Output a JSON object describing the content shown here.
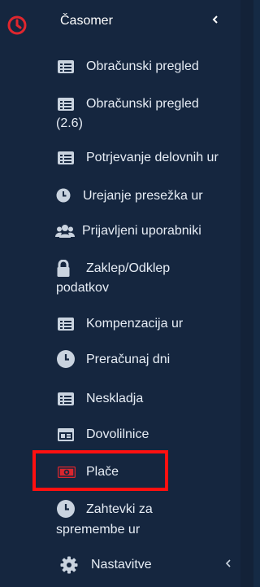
{
  "app": {
    "title": "Časomer"
  },
  "menu": {
    "items": [
      {
        "label": "Obračunski pregled",
        "icon": "list-icon"
      },
      {
        "label": "Obračunski pregled",
        "label2": "(2.6)",
        "icon": "list-icon"
      },
      {
        "label": "Potrjevanje delovnih ur",
        "icon": "list-icon"
      },
      {
        "label": "Urejanje presežka ur",
        "icon": "clock-icon"
      },
      {
        "label": "Prijavljeni uporabniki",
        "icon": "users-icon"
      },
      {
        "label": "Zaklep/Odklep",
        "label2": "podatkov",
        "icon": "lock-icon"
      },
      {
        "label": "Kompenzacija ur",
        "icon": "list-icon"
      },
      {
        "label": "Preračunaj dni",
        "icon": "clock-icon"
      },
      {
        "label": "Neskladja",
        "icon": "list-icon"
      },
      {
        "label": "Dovolilnice",
        "icon": "window-icon"
      },
      {
        "label": "Plače",
        "icon": "money-icon"
      },
      {
        "label": "Zahtevki za",
        "label2": "spremembe ur",
        "icon": "clock-icon"
      },
      {
        "label": "Nastavitve",
        "icon": "gear-icon"
      }
    ]
  },
  "colors": {
    "background": "#15263f",
    "text": "#e7edf5",
    "icon": "#c9d3df",
    "accent_red": "#ff1010"
  }
}
